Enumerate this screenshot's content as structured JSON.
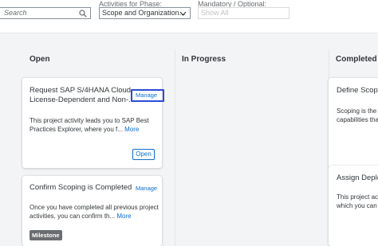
{
  "filters": {
    "search_placeholder": "Search",
    "phase_label": "Activities for Phase:",
    "phase_value": "Scope and Organization...",
    "mandatory_label": "Mandatory / Optional:",
    "mandatory_value": "Show All"
  },
  "board": {
    "columns": [
      {
        "title": "Open"
      },
      {
        "title": "In Progress"
      },
      {
        "title": "Completed"
      }
    ],
    "open_cards": [
      {
        "title_line1": "Request SAP S/4HANA Cloud",
        "title_line2": "License-Dependent and Non-...",
        "manage_label": "Manage",
        "desc_line1": "This project activity leads you to SAP Best",
        "desc_line2": "Practices Explorer, where you f...",
        "more_label": "More",
        "button_label": "Open"
      },
      {
        "title": "Confirm Scoping is Completed",
        "manage_label": "Manage",
        "desc_line1": "Once you have completed all previous project",
        "desc_line2": "activities, you can confirm th...",
        "more_label": "More",
        "badge_label": "Milestone"
      }
    ],
    "completed_cards": [
      {
        "title": "Define Scope",
        "desc_line1": "Scoping is the p",
        "desc_line2": "capabilities tha"
      },
      {
        "title": "Assign Deplo",
        "desc_line1": "This project acti",
        "desc_line2": "which you can a"
      }
    ]
  },
  "colors": {
    "link": "#0a6ed1",
    "focus_outline": "#2b4bd6",
    "badge": "#6a6d70"
  }
}
